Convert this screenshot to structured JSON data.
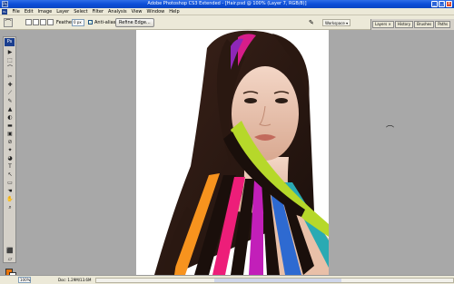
{
  "window": {
    "title": "Adobe Photoshop CS3 Extended - [Hair.psd @ 100% (Layer 7, RGB/8)]",
    "app_badge": "Ps",
    "controls": {
      "minimize": "_",
      "maximize": "□",
      "close": "x"
    }
  },
  "menu": {
    "logo": "Ps",
    "items": [
      "File",
      "Edit",
      "Image",
      "Layer",
      "Select",
      "Filter",
      "Analysis",
      "View",
      "Window",
      "Help"
    ]
  },
  "options_bar": {
    "tool_icon": "lasso-icon",
    "feather_label": "Feather:",
    "feather_value": "0 px",
    "antialias_label": "Anti-alias",
    "refine_edge_label": "Refine Edge...",
    "brush_icon": "brush-icon",
    "workspace_label": "Workspace ▾"
  },
  "palette_well": {
    "tabs": [
      "Layers ×",
      "History",
      "Brushes",
      "Paths"
    ]
  },
  "toolbox": {
    "logo": "Ps",
    "tools": [
      "▶",
      "⬚",
      "⌒",
      "✂",
      "✚",
      "⟋",
      "✎",
      "▲",
      "◐",
      "▬",
      "▣",
      "⊘",
      "✦",
      "◕",
      "T",
      "↖",
      "▭",
      "☚",
      "✋",
      "⌕",
      "⬛",
      "◯",
      "▱"
    ],
    "fg_color": "#e8740c",
    "bg_color": "#ffffff"
  },
  "canvas": {
    "image_description_colors": [
      "#f7931e",
      "#ed1e79",
      "#c21fb9",
      "#2e6ad1",
      "#2aaab3",
      "#b6d82a"
    ]
  },
  "status": {
    "zoom": "100%",
    "doc_info": "Doc: 1.29M/13.6M"
  }
}
